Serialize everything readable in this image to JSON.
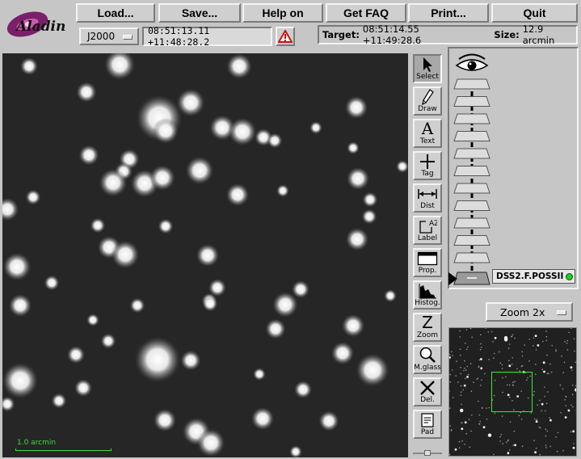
{
  "toolbar": {
    "load_label": "Load...",
    "save_label": "Save...",
    "help_label": "Help on",
    "faq_label": "Get FAQ",
    "print_label": "Print...",
    "quit_label": "Quit"
  },
  "logo": {
    "text": "Aladin"
  },
  "coords": {
    "frame": "J2000",
    "position": "08:51:13.11 +11:48:28.2",
    "target_label": "Target:",
    "target_value": "08:51:14.55 +11:49:28.6",
    "size_label": "Size:",
    "size_value": "12.9 arcmin"
  },
  "view": {
    "scale_label": "1.0 arcmin"
  },
  "tools": [
    {
      "label": "Select",
      "icon": "arrow-cursor-icon"
    },
    {
      "label": "Draw",
      "icon": "pencil-icon"
    },
    {
      "label": "Text",
      "icon": "letter-a-icon"
    },
    {
      "label": "Tag",
      "icon": "crosshair-plus-icon"
    },
    {
      "label": "Dist",
      "icon": "distance-arrow-icon"
    },
    {
      "label": "Label",
      "icon": "label-icon"
    },
    {
      "label": "Prop.",
      "icon": "window-icon"
    },
    {
      "label": "Histog.",
      "icon": "histogram-icon"
    },
    {
      "label": "Zoom",
      "icon": "letter-z-icon"
    },
    {
      "label": "M.glass",
      "icon": "magnifier-icon"
    },
    {
      "label": "Del.",
      "icon": "delete-x-icon"
    },
    {
      "label": "Pad",
      "icon": "notepad-icon"
    }
  ],
  "stack": {
    "layer_name": "DSS2.F.POSSII",
    "layer_status_color": "#22cc22"
  },
  "zoom": {
    "label": "Zoom 2x"
  },
  "colors": {
    "scale_bar": "#3bdc3b",
    "overview_frame": "#33ee33"
  }
}
